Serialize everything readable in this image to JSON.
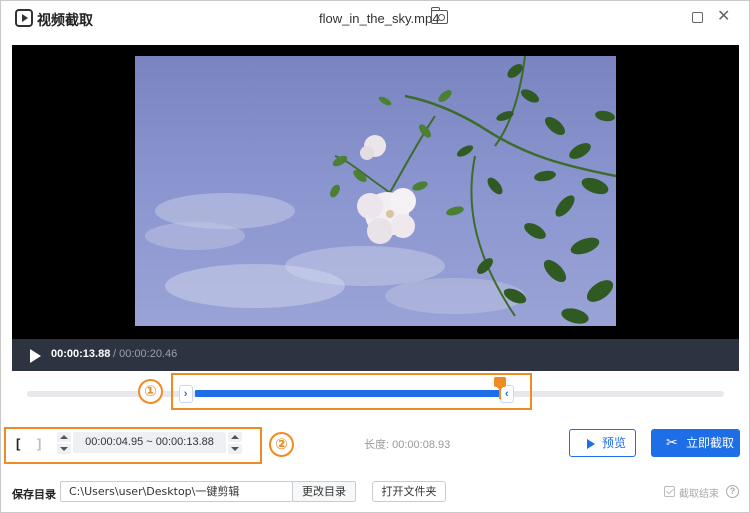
{
  "app": {
    "title": "视频截取",
    "file_name": "flow_in_the_sky.mp4"
  },
  "player": {
    "current_time": "00:00:13.88",
    "total_time": "/ 00:00:20.46"
  },
  "annotations": {
    "marker_1": "①",
    "marker_2": "②"
  },
  "timeline": {
    "range_start_handle": "›",
    "range_end_handle": "‹",
    "selection_start_fraction": 0.2375,
    "selection_end_fraction": 0.6784,
    "playhead_fraction": 0.6784
  },
  "clip": {
    "open_bracket": "[",
    "close_bracket": "]",
    "range_value": "00:00:04.95 ~ 00:00:13.88",
    "length_text": "长度: 00:00:08.93"
  },
  "actions": {
    "preview_label": "预览",
    "cut_label": "立即截取"
  },
  "save": {
    "label": "保存目录",
    "path": "C:\\Users\\user\\Desktop\\一键剪辑",
    "change_label": "更改目录",
    "open_folder_label": "打开文件夹",
    "finish_check_label": "截取结束"
  },
  "colors": {
    "accent": "#1e6ee8",
    "annotation": "#f08a24",
    "player_bar": "#2d3340"
  }
}
